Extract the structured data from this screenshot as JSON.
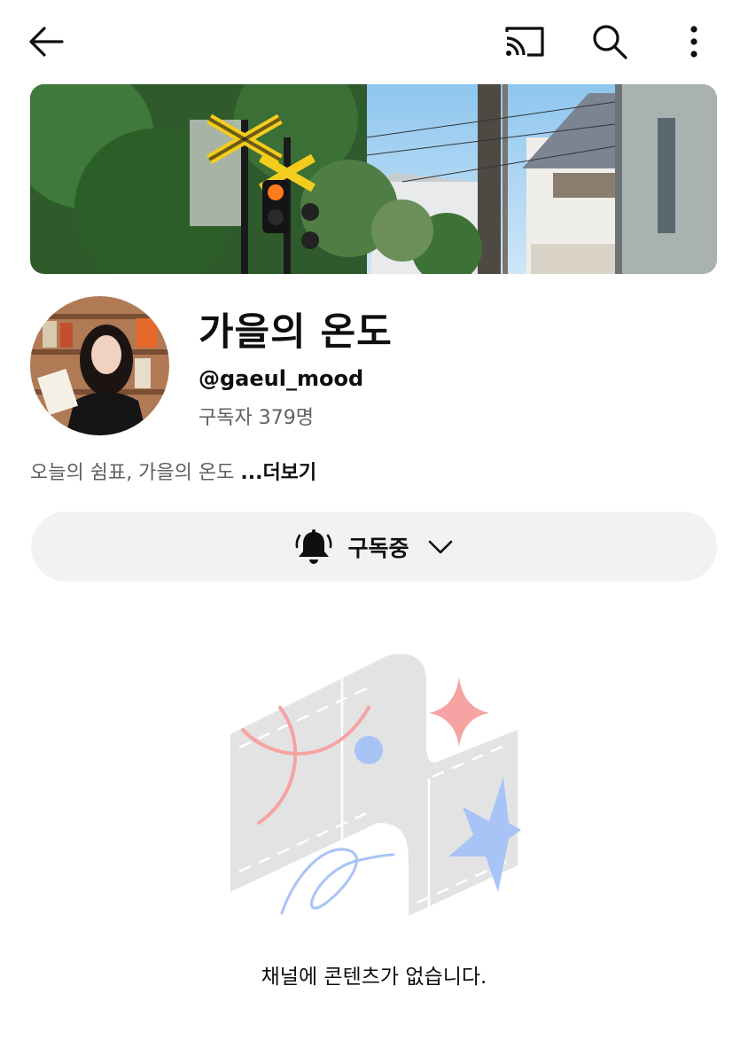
{
  "topbar": {
    "icons": [
      "arrow-back-icon",
      "cast-icon",
      "search-icon",
      "more-vert-icon"
    ]
  },
  "channel": {
    "name": "가을의 온도",
    "handle": "@gaeul_mood",
    "subscribers_label": "구독자 379명",
    "description": "오늘의 쉼표, 가을의 온도",
    "more_label": "...더보기"
  },
  "subscribe_button": {
    "label": "구독중",
    "icon": "bell-icon",
    "dropdown_icon": "chevron-down-icon"
  },
  "empty_state": {
    "message": "채널에 콘텐츠가 없습니다.",
    "illustration": "empty-channel-illustration"
  },
  "colors": {
    "button_bg": "#f2f2f2",
    "secondary_text": "#606060",
    "illustration_gray": "#e3e3e3",
    "illustration_pink": "#f6a3a3",
    "illustration_blue": "#a8c4f7"
  }
}
